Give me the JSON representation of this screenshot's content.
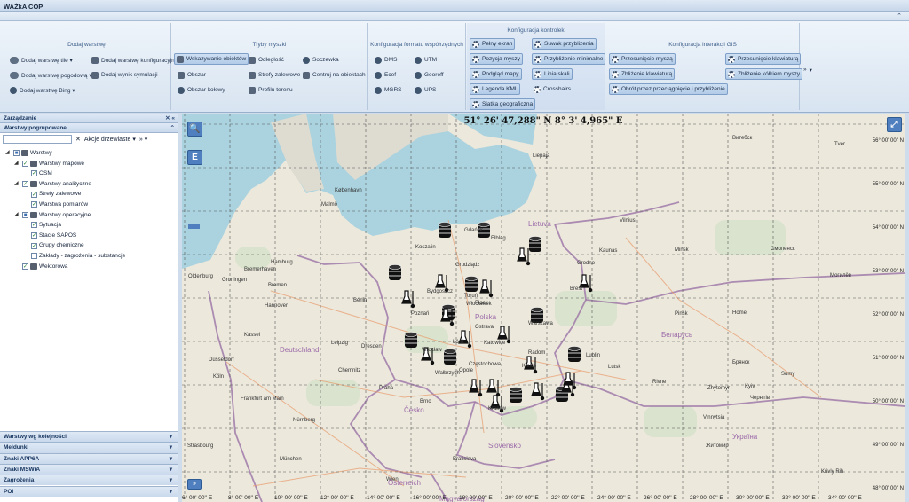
{
  "app": {
    "title": "WAŻkA COP"
  },
  "ribbon": {
    "groups": [
      "Dodaj warstwę",
      "Tryby myszki",
      "Konfiguracja formatu współrzędnych",
      "Konfiguracja kontrolek",
      "Konfiguracja interakcji GIS"
    ],
    "add_layer": [
      "Dodaj warstwę tile ▾",
      "Dodaj warstwę konfiguracyjne ▾",
      "Dodaj warstwę pogodową ▾",
      "Dodaj wynik symulacji",
      "Dodaj warstwę Bing ▾"
    ],
    "mouse": [
      "Wskazywanie obiektów",
      "Odległość",
      "Soczewka",
      "Obszar",
      "Strefy zalewowe",
      "Centruj na obiektach",
      "Obszar kołowy",
      "Profilu terenu"
    ],
    "coords": [
      "DMS",
      "UTM",
      "Ecef",
      "Georeff",
      "MGRS",
      "UPS"
    ],
    "controls": [
      "Pełny ekran",
      "Suwak przybliżenia",
      "Pozycja myszy",
      "Przybliżenie minimalne",
      "Podgląd mapy",
      "Linia skali",
      "Legenda KML",
      "Crosshairs",
      "Siatka geograficzna"
    ],
    "gis": [
      "Przesunięcie myszą",
      "Przesunięcie klawiaturą",
      "Zbliżenie klawiaturą",
      "Zbliżenie kółkiem myszy",
      "Obrót przez przeciągnięcie i przybliżenie"
    ],
    "more": "»"
  },
  "sidebar": {
    "title": "Zarządzanie",
    "sub": "Warstwy pogrupowane",
    "tree_actions": "Akcje drzewiaste ▾",
    "more": "» ▾",
    "tree": [
      {
        "label": "Warstwy",
        "level": 0,
        "fold": "◢",
        "checked": "partial"
      },
      {
        "label": "Warstwy mapowe",
        "level": 1,
        "fold": "◢",
        "checked": "yes"
      },
      {
        "label": "OSM",
        "level": 2,
        "fold": "",
        "checked": "yes"
      },
      {
        "label": "Warstwy analityczne",
        "level": 1,
        "fold": "◢",
        "checked": "yes"
      },
      {
        "label": "Strefy zalewowe",
        "level": 2,
        "fold": "",
        "checked": "yes"
      },
      {
        "label": "Warstwa pomiarów",
        "level": 2,
        "fold": "",
        "checked": "yes"
      },
      {
        "label": "Warstwy operacyjne",
        "level": 1,
        "fold": "◢",
        "checked": "partial"
      },
      {
        "label": "Sytuacja",
        "level": 2,
        "fold": "",
        "checked": "yes"
      },
      {
        "label": "Stacje SAPOS",
        "level": 2,
        "fold": "",
        "checked": "yes"
      },
      {
        "label": "Grupy chemiczne",
        "level": 2,
        "fold": "",
        "checked": "yes"
      },
      {
        "label": "Zakłady - zagrożenia - substancje",
        "level": 2,
        "fold": "",
        "checked": "no"
      },
      {
        "label": "Wektorowa",
        "level": 1,
        "fold": "",
        "checked": "yes"
      }
    ],
    "accordion": [
      "Warstwy wg kolejności",
      "Meldunki",
      "Znaki APP6A",
      "Znaki MSWiA",
      "Zagrożenia",
      "POI"
    ]
  },
  "map": {
    "coordinate": "51° 26' 47,288\" N 8° 3' 4,965\" E",
    "search_icon": "🔍",
    "layer_btn": "E",
    "fullscreen": "⤢",
    "places": [
      "København",
      "Malmö",
      "Gdańsk",
      "Elbląg",
      "Koszalin",
      "Grudziądz",
      "Hamburg",
      "Bremen",
      "Bremerhaven",
      "Oldenburg",
      "Groningen",
      "Hannover",
      "Berlin",
      "Poznań",
      "Bydgoszcz",
      "Toruń",
      "Włocławek",
      "Płock",
      "Warszawa",
      "Łódź",
      "Radom",
      "Lublin",
      "Kielce",
      "Kraków",
      "Częstochowa",
      "Opole",
      "Katowice",
      "Wrocław",
      "Wałbrzych",
      "Praha",
      "Leipzig",
      "Dresden",
      "Chemnitz",
      "Kassel",
      "Düsseldorf",
      "Köln",
      "Frankfurt am Main",
      "Nürnberg",
      "München",
      "Strasbourg",
      "Wien",
      "Bratislava",
      "Brno",
      "Ostrava",
      "Vilnius",
      "Kaunas",
      "Grodno",
      "Minsk",
      "Brest",
      "Homel",
      "Pinsk",
      "Lutsk",
      "Rivne",
      "Zhytomyr",
      "Kyiv",
      "Vinnytsia",
      "Sumy",
      "Kriviy Rih",
      "Lietuva",
      "Polska",
      "Deutschland",
      "Česko",
      "Slovensko",
      "Österreich",
      "Magyarország",
      "Україна",
      "Беларусь",
      "Liepāja",
      "Tver",
      "Витебск",
      "Смоленск",
      "Могилёв",
      "Брянск",
      "Чернігів",
      "Житомир",
      "Вінниця"
    ],
    "lon_labels": [
      "6° 00' 00'' E",
      "8° 00' 00'' E",
      "10° 00' 00'' E",
      "12° 00' 00'' E",
      "14° 00' 00'' E",
      "16° 00' 00'' E",
      "18° 00' 00'' E",
      "20° 00' 00'' E",
      "22° 00' 00'' E",
      "24° 00' 00'' E",
      "26° 00' 00'' E",
      "28° 00' 00'' E",
      "30° 00' 00'' E",
      "32° 00' 00'' E",
      "34° 00' 00'' E"
    ],
    "lat_labels": [
      "56° 00' 00'' N",
      "55° 00' 00'' N",
      "54° 00' 00'' N",
      "53° 00' 00'' N",
      "52° 00' 00'' N",
      "51° 00' 00'' N",
      "50° 00' 00'' N",
      "49° 00' 00'' N",
      "48° 00' 00'' N"
    ],
    "markers": {
      "barrels": 12,
      "flasks": 16
    }
  },
  "colors": {
    "water": "#aad3df",
    "land": "#ece8dc",
    "border": "#9b73a6",
    "ribbon_accent": "#4f7fbf"
  }
}
